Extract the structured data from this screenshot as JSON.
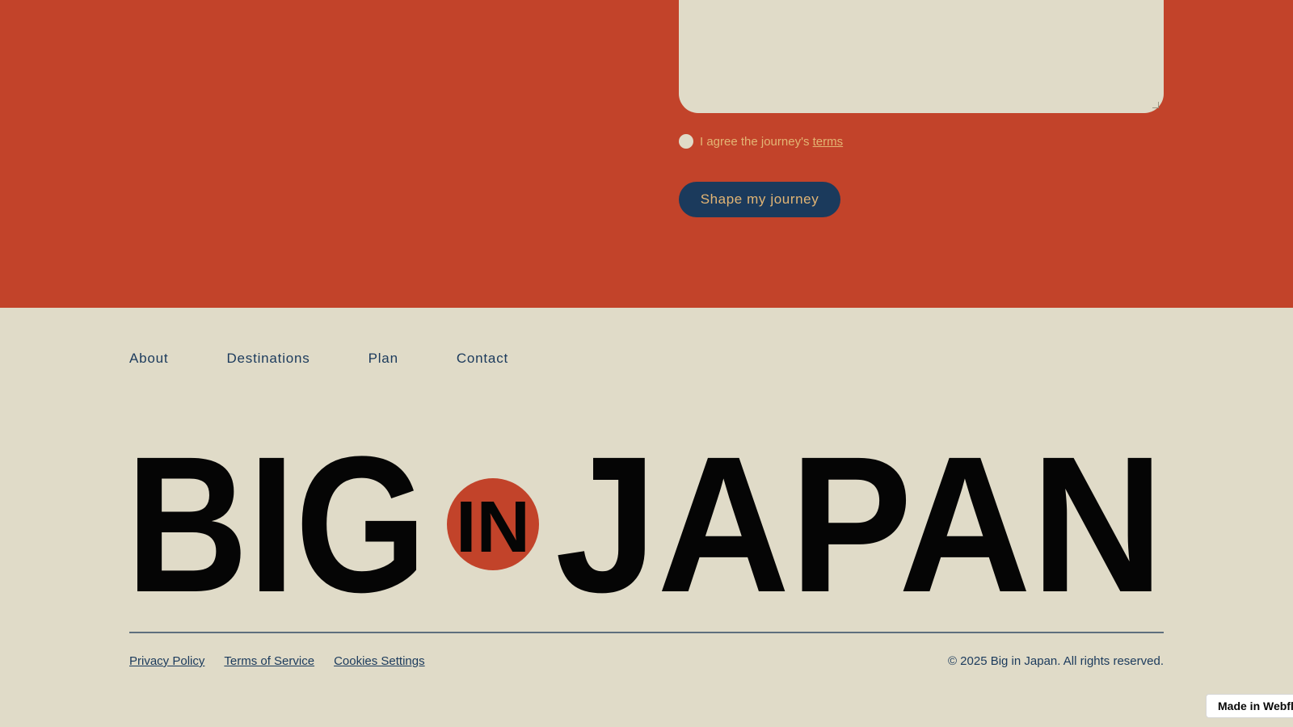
{
  "form": {
    "terms_prefix": "I agree the journey's ",
    "terms_link": "terms",
    "submit_label": "Shape my journey"
  },
  "footer_nav": {
    "items": [
      {
        "label": "About"
      },
      {
        "label": "Destinations"
      },
      {
        "label": "Plan"
      },
      {
        "label": "Contact"
      }
    ]
  },
  "logo": {
    "word_1": "BIG",
    "word_mid": "IN",
    "word_2": "JAPAN"
  },
  "legal": {
    "links": [
      {
        "label": "Privacy Policy"
      },
      {
        "label": "Terms of Service"
      },
      {
        "label": "Cookies Settings"
      }
    ],
    "copyright": "© 2025 Big in Japan. All rights reserved."
  },
  "badge": {
    "label": "Made in Webflow",
    "icon": "webflow-logo-icon"
  },
  "colors": {
    "brand_red": "#c2432a",
    "cream": "#e0dbc8",
    "navy": "#1b3a5c",
    "gold": "#e3b574"
  }
}
